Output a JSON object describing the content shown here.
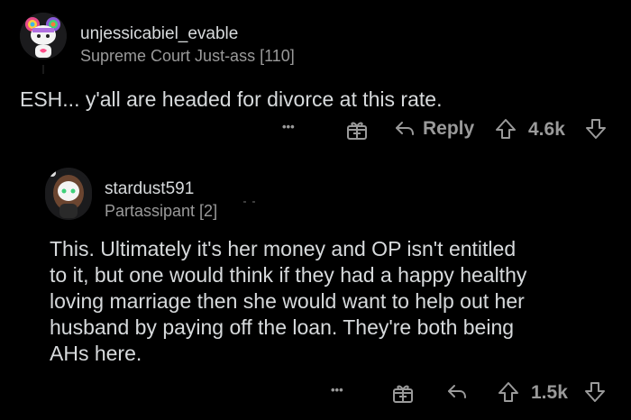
{
  "comments": [
    {
      "username": "unjessicabiel_evable",
      "flair": "Supreme Court Just-ass [110]",
      "body": "ESH... y'all are headed for divorce at this rate.",
      "actions": {
        "more": "•••",
        "reply_label": "Reply",
        "score": "4.6k"
      }
    },
    {
      "username": "stardust591",
      "flair": "Partassipant [2]",
      "body_lines": [
        "This. Ultimately it's her money and OP isn't entitled",
        "to it, but one would think if they had a happy healthy",
        "loving marriage then she would want to help out her",
        "husband by paying off the loan. They're both being",
        "AHs here."
      ],
      "actions": {
        "more": "•••",
        "score": "1.5k"
      }
    }
  ],
  "colors": {
    "background": "#000000",
    "text": "#d7dadc",
    "muted": "#9a9a9a"
  },
  "icons": {
    "award": "gift-icon",
    "reply": "reply-arrow-icon",
    "upvote": "upvote-arrow-icon",
    "downvote": "downvote-arrow-icon"
  }
}
